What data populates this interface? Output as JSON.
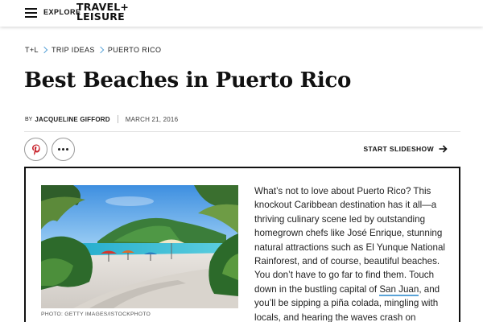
{
  "nav": {
    "explore_label": "EXPLORE",
    "logo_line1": "TRAVEL+",
    "logo_line2": "LEISURE"
  },
  "breadcrumb": {
    "items": [
      "T+L",
      "TRIP IDEAS",
      "PUERTO RICO"
    ]
  },
  "article": {
    "title": "Best Beaches in Puerto Rico",
    "by_label": "BY",
    "author": "JACQUELINE GIFFORD",
    "date": "MARCH 21, 2016",
    "slideshow_label": "START SLIDESHOW",
    "photo_caption": "PHOTO: GETTY IMAGES/ISTOCKPHOTO",
    "body_before_link": "What’s not to love about Puerto Rico? This knockout Caribbean destination has it all—a thriving culinary scene led by outstanding homegrown chefs like José Enrique, stunning natural attractions such as El Yunque National Rainforest, and of course, beautiful beaches. You don’t have to go far to find them. Touch down in the bustling capital of ",
    "body_link": "San Juan",
    "body_after_link": ", and you’ll be sipping a piña colada, mingling with locals, and hearing the waves crash on"
  },
  "icons": {
    "menu": "hamburger-icon",
    "pinterest": "pinterest-icon",
    "more": "more-dots-icon",
    "arrow": "arrow-right-icon"
  },
  "colors": {
    "accent_blue": "#5aa3d8",
    "pinterest_red": "#c8232c",
    "text": "#111111"
  }
}
